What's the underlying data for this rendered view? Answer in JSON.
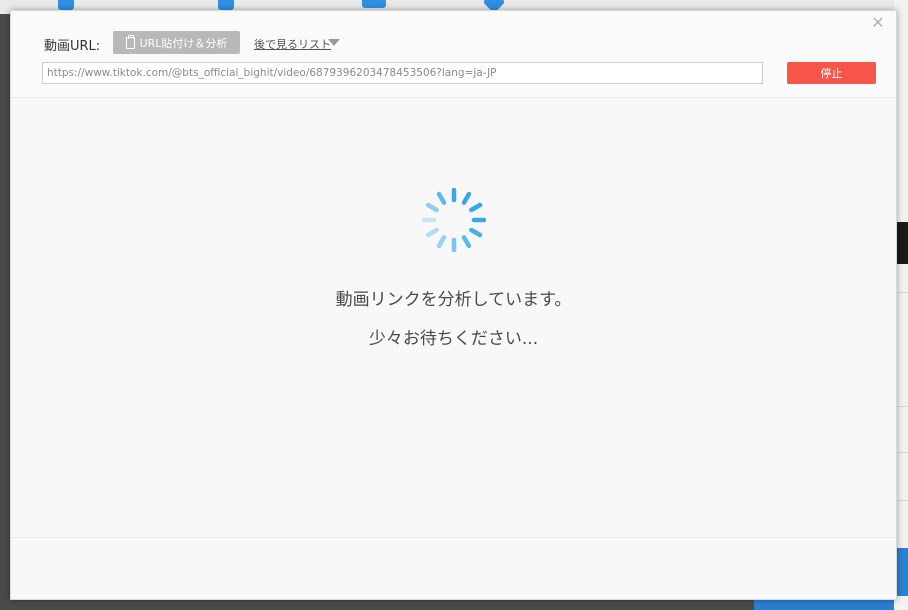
{
  "dialog": {
    "url_label": "動画URL:",
    "paste_button_label": "URL貼付け＆分析",
    "watch_later_label": "後で見るリスト",
    "url_value": "https://www.tiktok.com/@bts_official_bighit/video/6879396203478453506?lang=ja-JP",
    "stop_button_label": "停止",
    "loading_message": "動画リンクを分析しています。",
    "wait_message": "少々お待ちください..."
  },
  "icons": {
    "close": "close-icon",
    "paste": "clipboard-icon",
    "dropdown": "caret-down-icon",
    "loading": "loading-spinner-icon"
  },
  "colors": {
    "stop_button": "#f7544a",
    "paste_button": "#b8b8b8",
    "spinner": "#3aa7e8"
  }
}
